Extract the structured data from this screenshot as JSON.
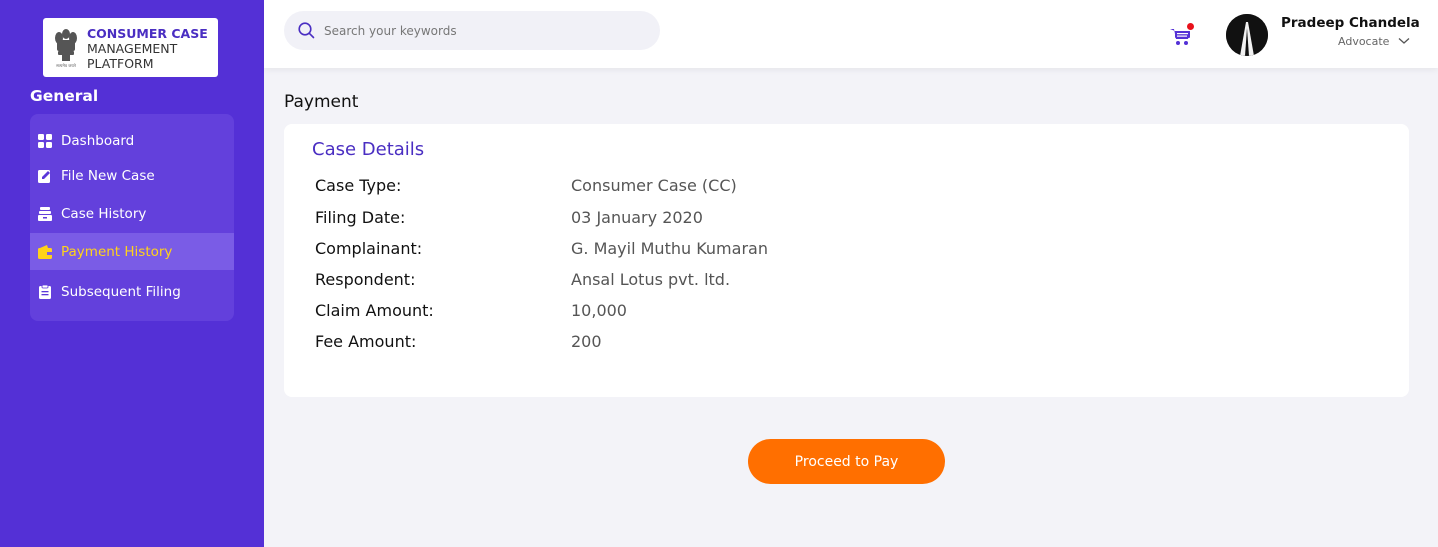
{
  "logo": {
    "line1": "CONSUMER CASE",
    "line2": "MANAGEMENT",
    "line3": "PLATFORM",
    "emblem_caption": "सत्यमेव जयते"
  },
  "sidebar": {
    "section_label": "General",
    "items": [
      {
        "label": "Dashboard",
        "icon": "grid-icon"
      },
      {
        "label": "File New Case",
        "icon": "edit-icon"
      },
      {
        "label": "Case History",
        "icon": "archive-icon"
      },
      {
        "label": "Payment History",
        "icon": "wallet-icon",
        "active": true
      },
      {
        "label": "Subsequent Filing",
        "icon": "clipboard-icon"
      }
    ]
  },
  "topbar": {
    "search_placeholder": "Search your keywords",
    "user_name": "Pradeep Chandela",
    "user_role": "Advocate"
  },
  "page": {
    "title": "Payment",
    "card_title": "Case Details",
    "details": [
      {
        "label": "Case Type:",
        "value": "Consumer Case (CC)"
      },
      {
        "label": "Filing Date:",
        "value": "03 January 2020"
      },
      {
        "label": "Complainant:",
        "value": "G. Mayil Muthu Kumaran"
      },
      {
        "label": "Respondent:",
        "value": "Ansal Lotus pvt. ltd."
      },
      {
        "label": "Claim Amount:",
        "value": "10,000"
      },
      {
        "label": "Fee Amount:",
        "value": "200"
      }
    ],
    "pay_button": "Proceed to Pay"
  },
  "colors": {
    "sidebar_bg": "#5430d6",
    "accent": "#4a2ec2",
    "active_text": "#ffd21a",
    "pay_button": "#ff6f00",
    "notification_dot": "#e8111b"
  }
}
